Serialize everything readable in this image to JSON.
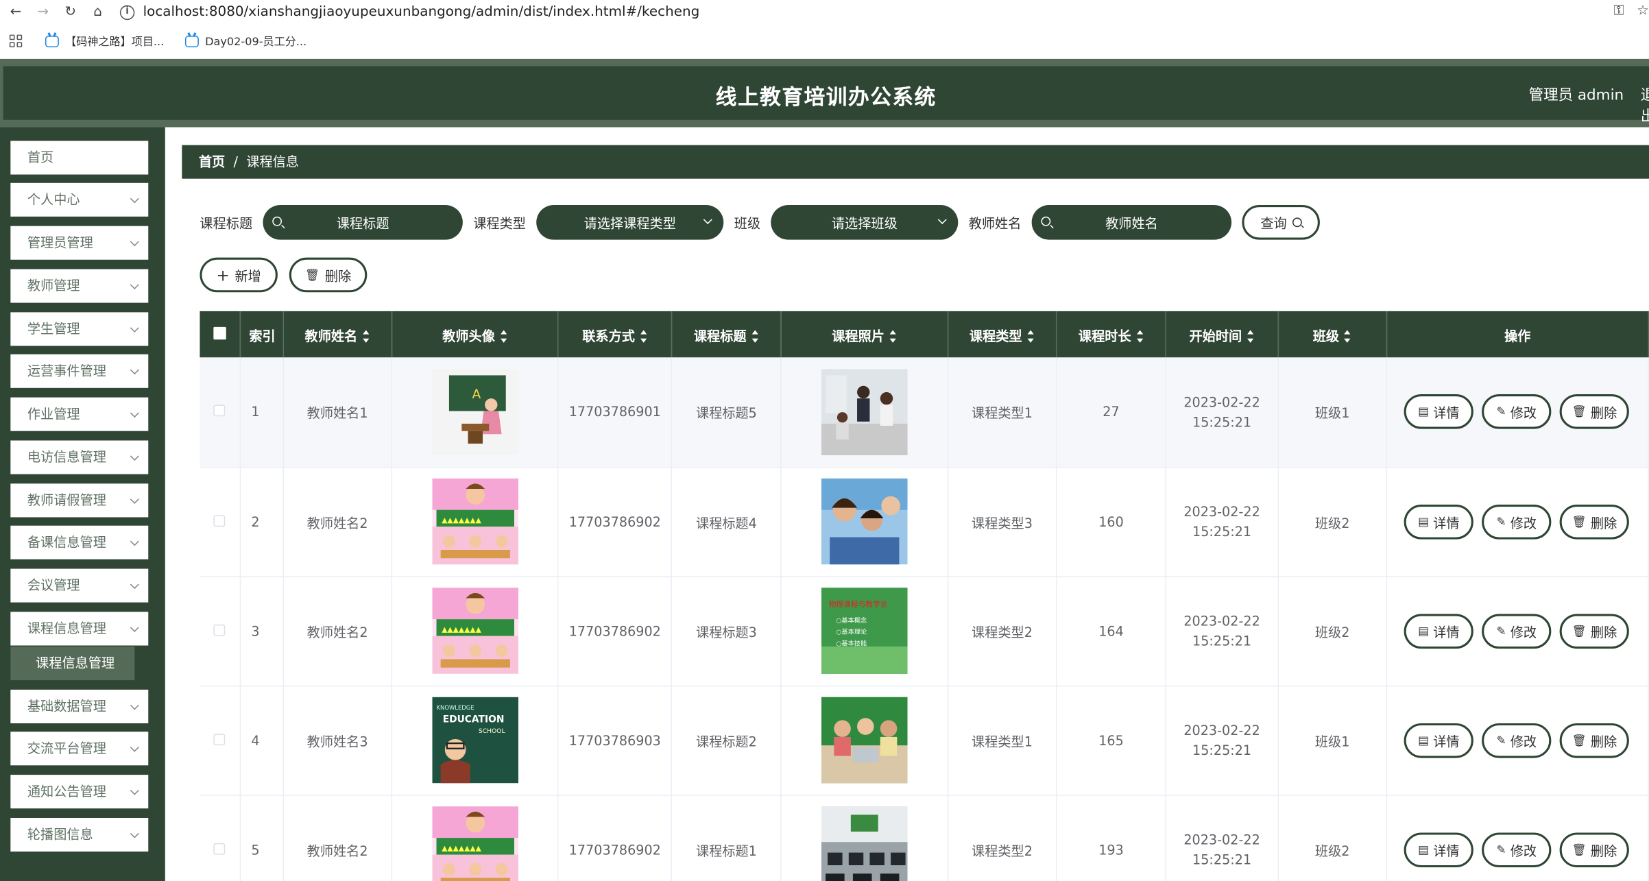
{
  "browser": {
    "url": "localhost:8080/xianshangjiaoyupeuxunbangong/admin/dist/index.html#/kecheng",
    "bookmarks": [
      "【码神之路】项目...",
      "Day02-09-员工分..."
    ]
  },
  "header": {
    "title": "线上教育培训办公系统",
    "user": "管理员 admin",
    "logout": "退出登录"
  },
  "sidebar": {
    "items": [
      {
        "label": "首页",
        "has_arrow": false
      },
      {
        "label": "个人中心",
        "has_arrow": true
      },
      {
        "label": "管理员管理",
        "has_arrow": true
      },
      {
        "label": "教师管理",
        "has_arrow": true
      },
      {
        "label": "学生管理",
        "has_arrow": true
      },
      {
        "label": "运营事件管理",
        "has_arrow": true
      },
      {
        "label": "作业管理",
        "has_arrow": true
      },
      {
        "label": "电访信息管理",
        "has_arrow": true
      },
      {
        "label": "教师请假管理",
        "has_arrow": true
      },
      {
        "label": "备课信息管理",
        "has_arrow": true
      },
      {
        "label": "会议管理",
        "has_arrow": true
      },
      {
        "label": "课程信息管理",
        "has_arrow": true
      },
      {
        "label": "基础数据管理",
        "has_arrow": true
      },
      {
        "label": "交流平台管理",
        "has_arrow": true
      },
      {
        "label": "通知公告管理",
        "has_arrow": true
      },
      {
        "label": "轮播图信息",
        "has_arrow": true
      }
    ],
    "active_sub": "课程信息管理"
  },
  "breadcrumb": {
    "home": "首页",
    "separator": "/",
    "current": "课程信息"
  },
  "search": {
    "title_label": "课程标题",
    "title_placeholder": "课程标题",
    "type_label": "课程类型",
    "type_placeholder": "请选择课程类型",
    "class_label": "班级",
    "class_placeholder": "请选择班级",
    "teacher_label": "教师姓名",
    "teacher_placeholder": "教师姓名",
    "query_button": "查询"
  },
  "actions": {
    "add": "新增",
    "delete": "删除",
    "add_icon": "+",
    "delete_icon": "trash-icon"
  },
  "table": {
    "headers": [
      "索引",
      "教师姓名",
      "教师头像",
      "联系方式",
      "课程标题",
      "课程照片",
      "课程类型",
      "课程时长",
      "开始时间",
      "班级",
      "操作"
    ],
    "row_buttons": {
      "detail": "详情",
      "edit": "修改",
      "delete": "删除"
    },
    "rows": [
      {
        "index": "1",
        "teacher": "教师姓名1",
        "avatar": "teacher-at-blackboard",
        "phone": "17703786901",
        "title": "课程标题5",
        "photo": "classroom-students",
        "type": "课程类型1",
        "duration": "27",
        "start_time": "2023-02-22 15:25:21",
        "class": "班级1"
      },
      {
        "index": "2",
        "teacher": "教师姓名2",
        "avatar": "cartoon-teacher-pink",
        "phone": "17703786902",
        "title": "课程标题4",
        "photo": "smiling-children",
        "type": "课程类型3",
        "duration": "160",
        "start_time": "2023-02-22 15:25:21",
        "class": "班级2"
      },
      {
        "index": "3",
        "teacher": "教师姓名2",
        "avatar": "cartoon-teacher-pink",
        "phone": "17703786902",
        "title": "课程标题3",
        "photo": "green-course-slide",
        "type": "课程类型2",
        "duration": "164",
        "start_time": "2023-02-22 15:25:21",
        "class": "班级2"
      },
      {
        "index": "4",
        "teacher": "教师姓名3",
        "avatar": "education-chalkboard",
        "phone": "17703786903",
        "title": "课程标题2",
        "photo": "kids-with-laptop",
        "type": "课程类型1",
        "duration": "165",
        "start_time": "2023-02-22 15:25:21",
        "class": "班级1"
      },
      {
        "index": "5",
        "teacher": "教师姓名2",
        "avatar": "cartoon-teacher-pink",
        "phone": "17703786902",
        "title": "课程标题1",
        "photo": "computer-lab",
        "type": "课程类型2",
        "duration": "193",
        "start_time": "2023-02-22 15:25:21",
        "class": "班级2"
      }
    ],
    "slide_text": [
      "物理课程与教学论",
      "○基本概念",
      "○基本理论",
      "○基本技能"
    ],
    "education_text": [
      "EDUCATION",
      "SCHOOL",
      "KNOWLEDGE"
    ]
  },
  "colors": {
    "primary": "#2f4634",
    "band": "#556b58",
    "white": "#ffffff"
  }
}
